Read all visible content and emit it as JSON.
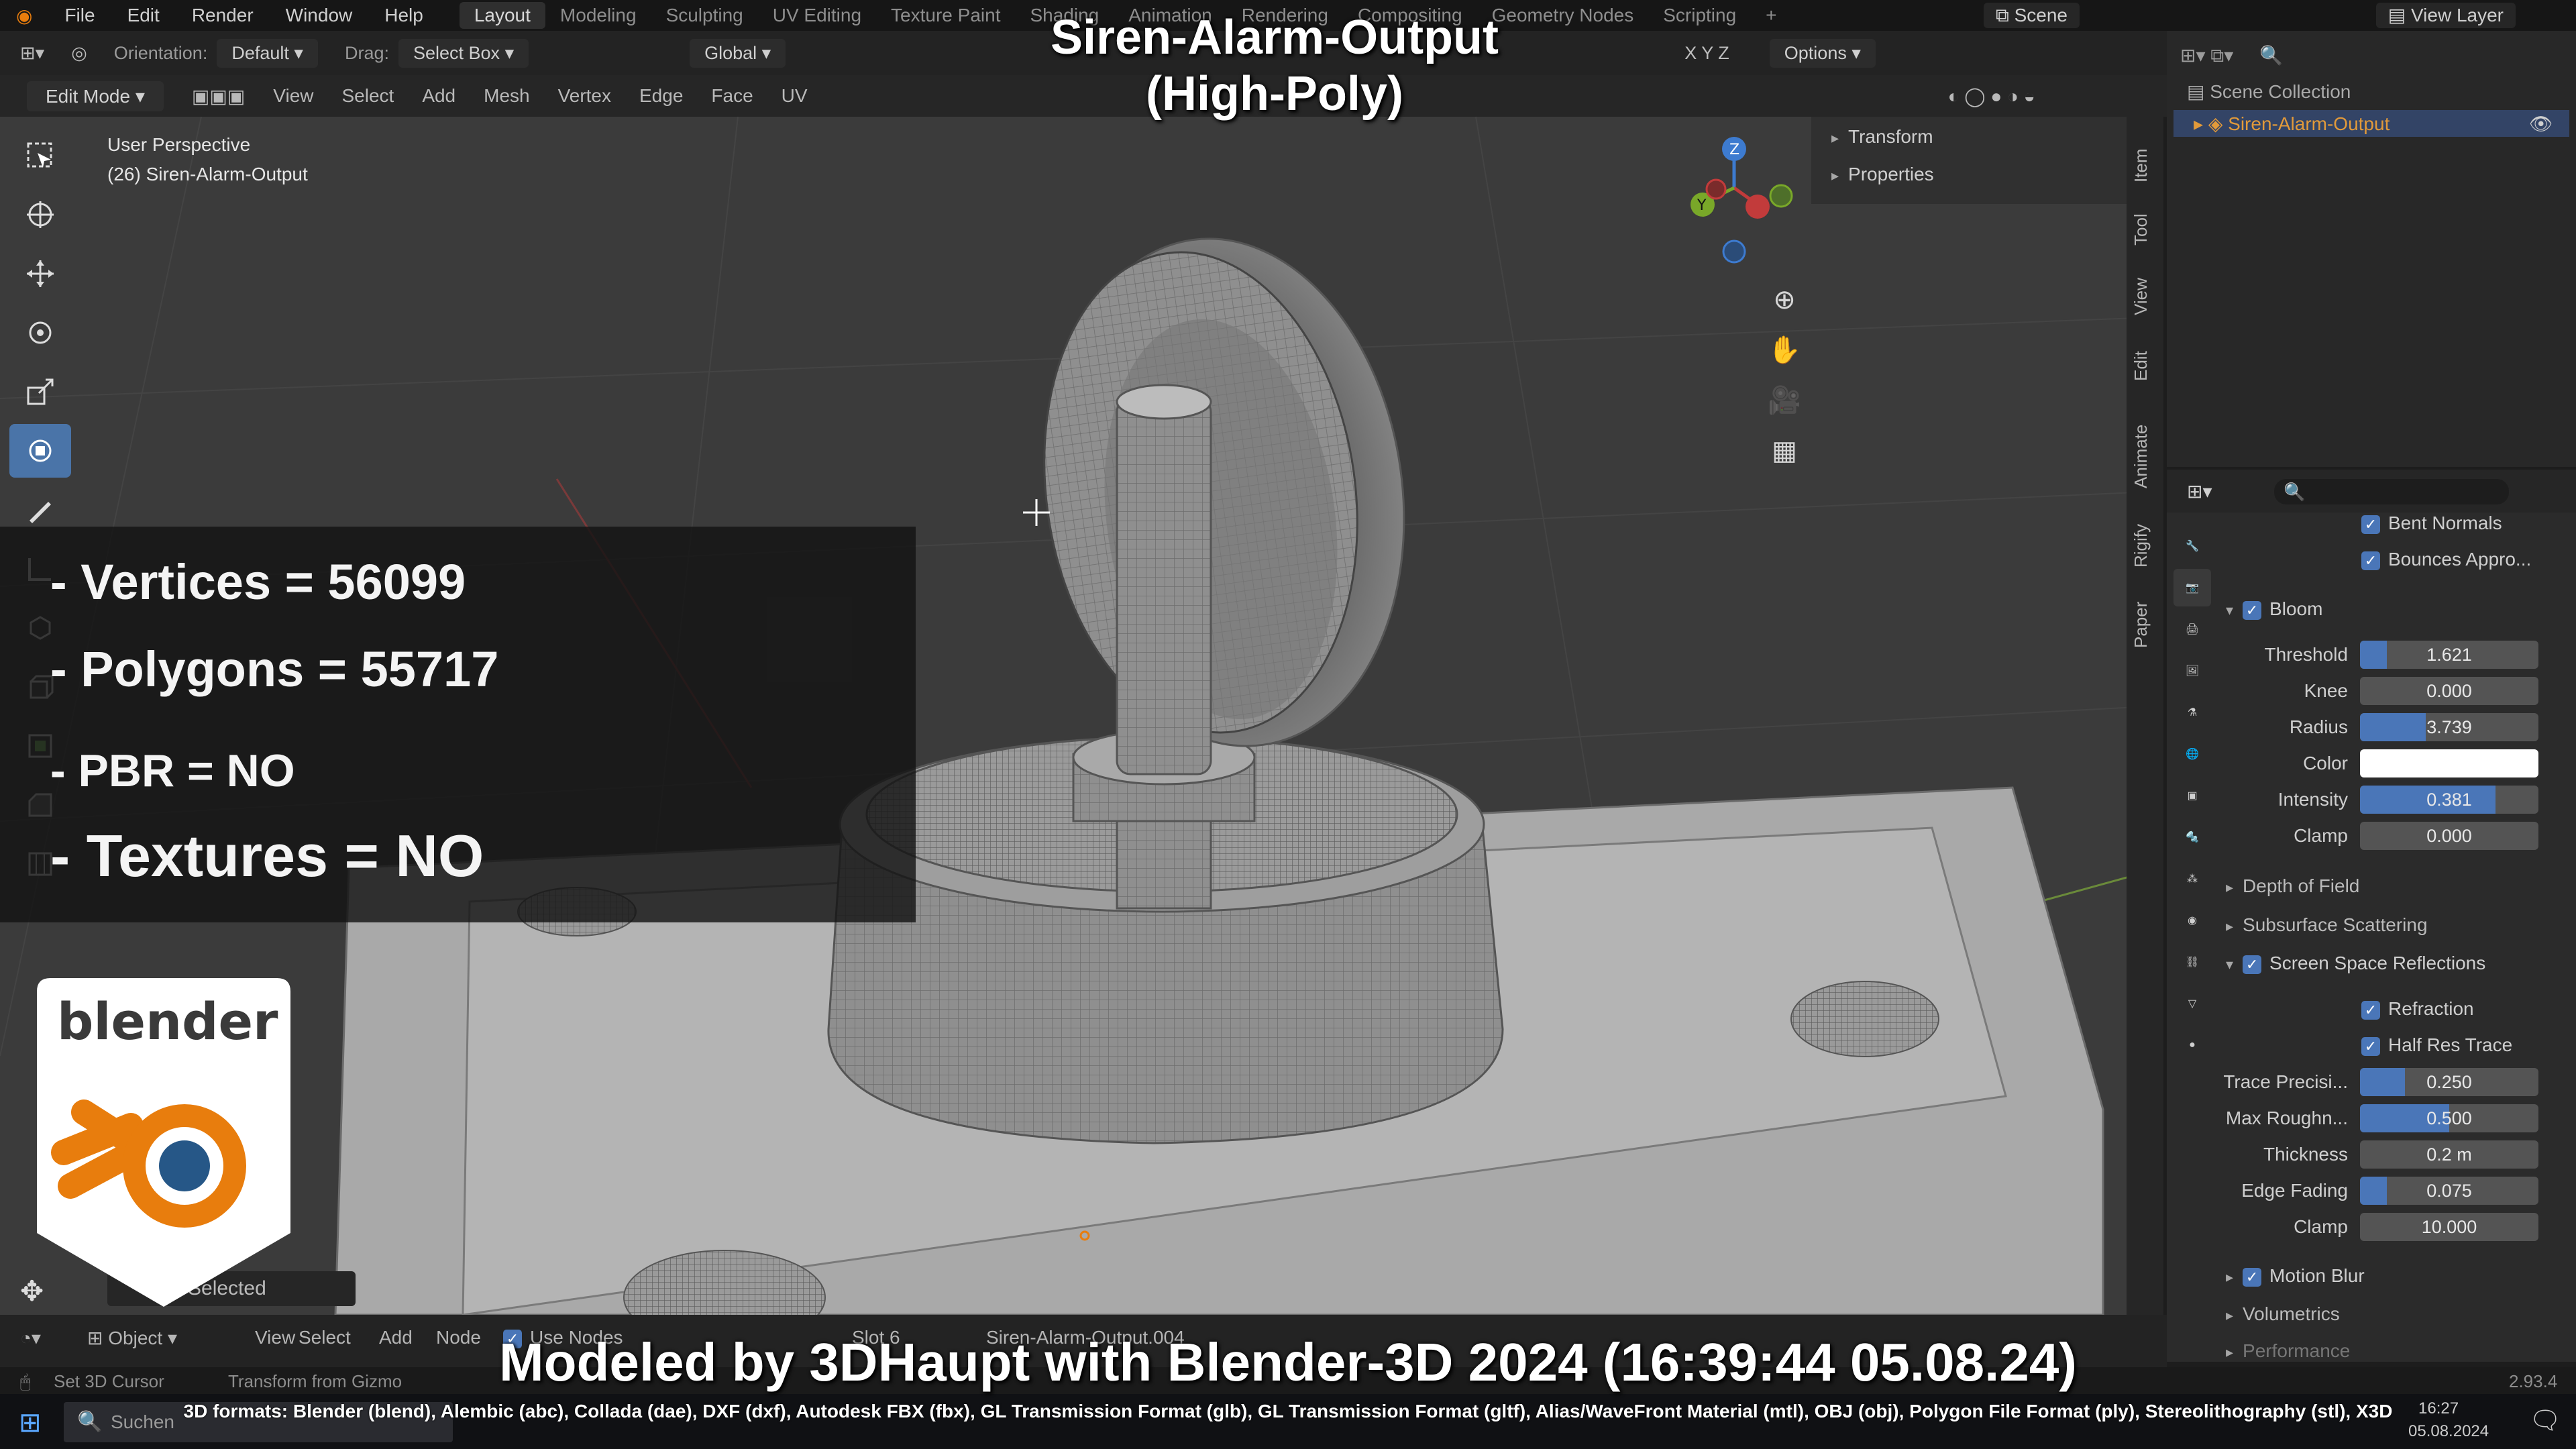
{
  "menu": {
    "items": [
      "File",
      "Edit",
      "Render",
      "Window",
      "Help"
    ],
    "workspaces": [
      "Layout",
      "Modeling",
      "Sculpting",
      "UV Editing",
      "Texture Paint",
      "Shading",
      "Animation",
      "Rendering",
      "Compositing",
      "Geometry Nodes",
      "Scripting"
    ],
    "active_workspace": "Layout",
    "scene": "Scene",
    "view_layer": "View Layer"
  },
  "tool_settings": {
    "orientation_label": "Orientation:",
    "orientation_value": "Default",
    "drag_label": "Drag:",
    "drag_value": "Select Box",
    "transform_orientation": "Global",
    "options": "Options"
  },
  "viewport_header": {
    "mode": "Edit Mode",
    "menus": [
      "View",
      "Select",
      "Add",
      "Mesh",
      "Vertex",
      "Edge",
      "Face",
      "UV"
    ]
  },
  "viewport": {
    "perspective": "User Perspective",
    "object_info": "(26) Siren-Alarm-Output",
    "selected_text": "Selected"
  },
  "overlay": {
    "title_line1": "Siren-Alarm-Output",
    "title_line2": "(High-Poly)",
    "stats": [
      "- Vertices = 56099",
      "- Polygons = 55717",
      "- PBR =  NO",
      "- Textures = NO"
    ],
    "logo_text": "blender",
    "credit": "Modeled by 3DHaupt with Blender-3D 2024 (16:39:44  05.08.24)",
    "formats": "3D formats: Blender (blend), Alembic (abc), Collada (dae), DXF (dxf), Autodesk FBX (fbx), GL Transmission Format (glb), GL Transmission Format (gltf), Alias/WaveFront Material (mtl), OBJ (obj), Polygon File Format (ply), Stereolithography (stl), X3D"
  },
  "npanel": {
    "items": [
      "Transform",
      "Properties"
    ],
    "tabs": [
      "Item",
      "Tool",
      "View",
      "Edit",
      "Animate",
      "Rigify",
      "Paper"
    ]
  },
  "outliner": {
    "header": "Scene Collection",
    "item": "Siren-Alarm-Output"
  },
  "properties": {
    "top_checks": [
      "Bent Normals",
      "Bounces Appro..."
    ],
    "bloom": {
      "label": "Bloom",
      "rows": [
        {
          "label": "Threshold",
          "value": "1.621",
          "fill": 0.15
        },
        {
          "label": "Knee",
          "value": "0.000",
          "fill": 0
        },
        {
          "label": "Radius",
          "value": "3.739",
          "fill": 0.37
        },
        {
          "label": "Color",
          "value": "",
          "fill": 0
        },
        {
          "label": "Intensity",
          "value": "0.381",
          "fill": 0.76
        },
        {
          "label": "Clamp",
          "value": "0.000",
          "fill": 0
        }
      ]
    },
    "collapsed": [
      "Depth of Field",
      "Subsurface Scattering"
    ],
    "ssr": {
      "label": "Screen Space Reflections",
      "checks": [
        "Refraction",
        "Half Res Trace"
      ],
      "rows": [
        {
          "label": "Trace Precisi...",
          "value": "0.250",
          "fill": 0.25
        },
        {
          "label": "Max Roughn...",
          "value": "0.500",
          "fill": 0.5
        },
        {
          "label": "Thickness",
          "value": "0.2 m",
          "fill": 0
        },
        {
          "label": "Edge Fading",
          "value": "0.075",
          "fill": 0.15
        },
        {
          "label": "Clamp",
          "value": "10.000",
          "fill": 0
        }
      ]
    },
    "motion_blur": "Motion Blur",
    "volumetrics": "Volumetrics",
    "performance": "Performance"
  },
  "bottom_header": {
    "mode": "Object",
    "menus": [
      "View",
      "Select",
      "Add",
      "Node"
    ],
    "use_nodes": "Use Nodes",
    "slot": "Slot 6",
    "material": "Siren-Alarm-Output.004"
  },
  "status": {
    "left": "Set 3D Cursor",
    "middle": "Transform from Gizmo",
    "version": "2.93.4"
  },
  "taskbar": {
    "search": "Suchen",
    "time": "16:27",
    "date": "05.08.2024"
  },
  "colors": {
    "accent": "#4a76b8",
    "viewport_bg": "#3b3b3b",
    "blender_orange": "#e87d0d",
    "blender_blue": "#265787"
  }
}
